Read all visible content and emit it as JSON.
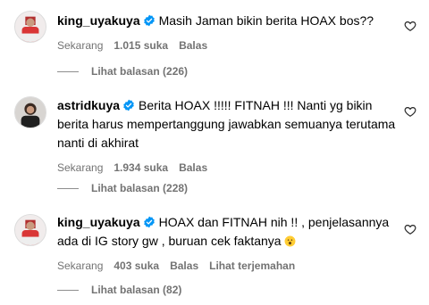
{
  "comments": [
    {
      "username": "king_uyakuya",
      "text": "Masih Jaman bikin berita HOAX bos??",
      "time": "Sekarang",
      "likes": "1.015 suka",
      "reply_label": "Balas",
      "view_replies": "Lihat balasan (226)"
    },
    {
      "username": "astridkuya",
      "text": "Berita HOAX !!!!! FITNAH !!! Nanti yg bikin berita harus mempertanggung jawabkan semuanya terutama nanti di akhirat",
      "time": "Sekarang",
      "likes": "1.934 suka",
      "reply_label": "Balas",
      "view_replies": "Lihat balasan (228)"
    },
    {
      "username": "king_uyakuya",
      "text": "HOAX dan FITNAH nih !! , penjelasannya ada di IG story gw , buruan cek faktanya",
      "time": "Sekarang",
      "likes": "403 suka",
      "reply_label": "Balas",
      "translate_label": "Lihat terjemahan",
      "view_replies": "Lihat balasan (82)"
    }
  ],
  "colors": {
    "verified": "#0095f6",
    "meta": "#737373"
  },
  "icons": [
    "verified-badge-icon",
    "heart-icon",
    "surprised-face-emoji"
  ]
}
